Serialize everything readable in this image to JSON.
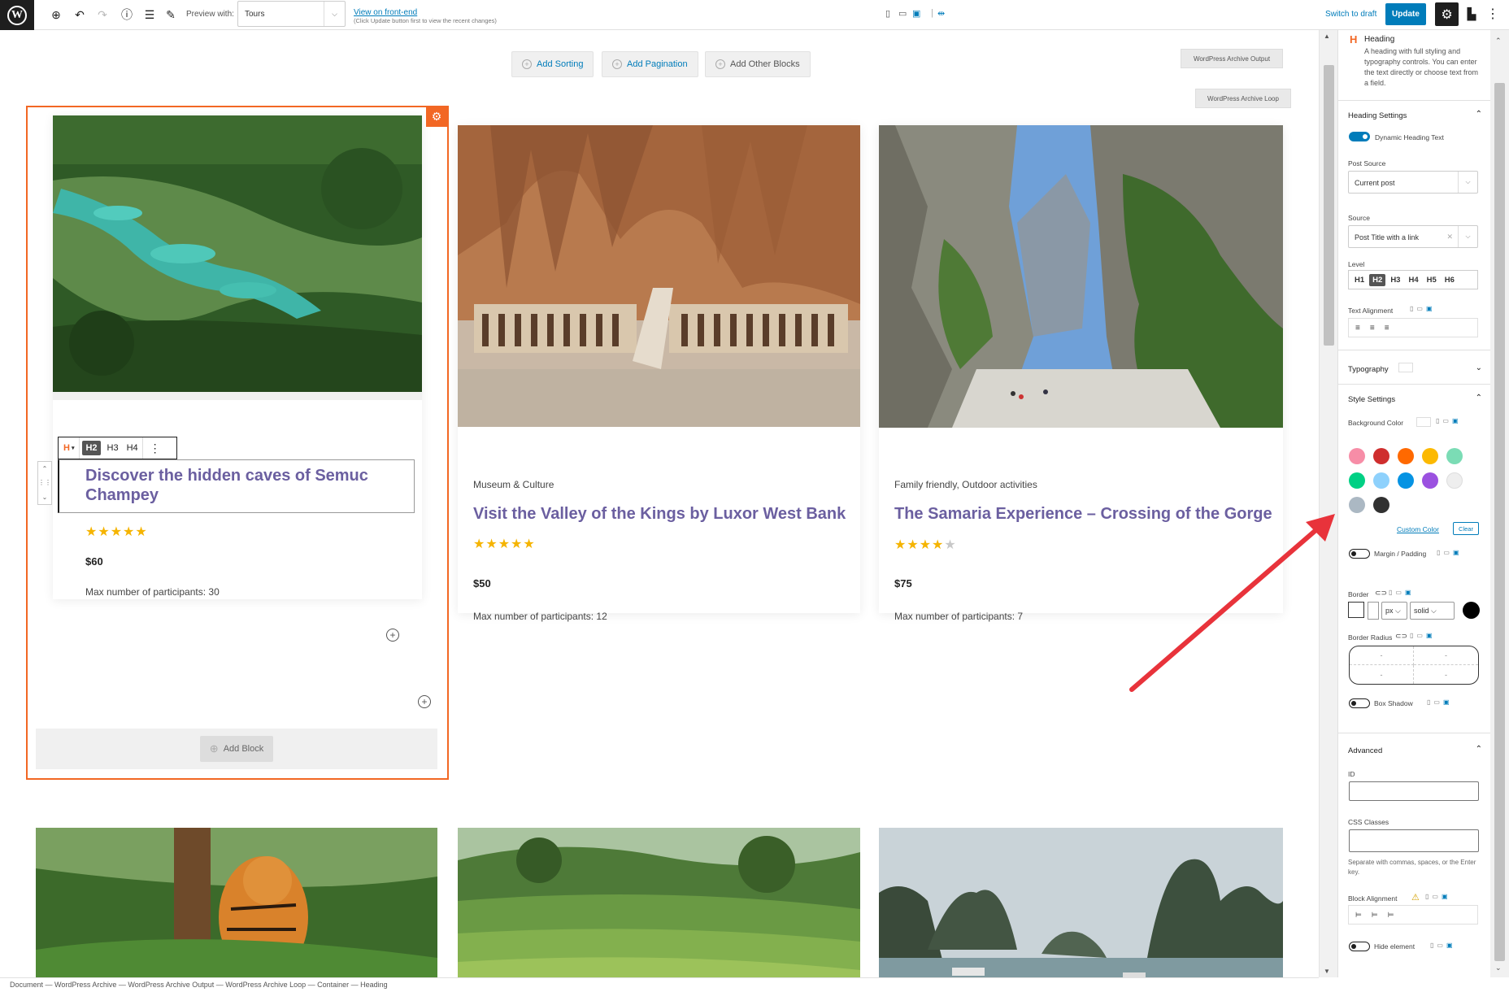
{
  "topbar": {
    "preview_label": "Preview with:",
    "preview_value": "Tours",
    "view_link": "View on front-end",
    "view_note": "(Click Update button first to view the recent changes)",
    "switch_draft": "Switch to draft",
    "update_label": "Update"
  },
  "canvas": {
    "add_sorting": "Add Sorting",
    "add_pagination": "Add Pagination",
    "add_other_blocks": "Add Other Blocks",
    "archive_output_label": "WordPress Archive Output",
    "archive_loop_label": "WordPress Archive Loop",
    "add_block_label": "Add Block"
  },
  "heading_toolbar": {
    "h_label": "H",
    "levels": [
      "H2",
      "H3",
      "H4"
    ]
  },
  "cards": [
    {
      "title": "Discover the hidden caves of Semuc Champey",
      "category": "",
      "stars_on": "★★★★★",
      "stars_off": "",
      "price": "$60",
      "max_participants": "Max number of participants: 30"
    },
    {
      "title": "Visit the Valley of the Kings by Luxor West Bank",
      "category": "Museum & Culture",
      "stars_on": "★★★★★",
      "stars_off": "",
      "price": "$50",
      "max_participants": "Max number of participants: 12"
    },
    {
      "title": "The Samaria Experience – Crossing of the Gorge",
      "category": "Family friendly, Outdoor activities",
      "stars_on": "★★★★",
      "stars_off": "★",
      "price": "$75",
      "max_participants": "Max number of participants: 7"
    }
  ],
  "breadcrumb": "Document  —  WordPress Archive  —  WordPress Archive Output  —  WordPress Archive Loop  —  Container  —  Heading",
  "sidebar": {
    "block_name": "Heading",
    "block_desc": "A heading with full styling and typography controls. You can enter the text directly or choose text from a field.",
    "heading_settings": "Heading Settings",
    "dynamic_heading": "Dynamic Heading Text",
    "post_source_label": "Post Source",
    "post_source_value": "Current post",
    "source_label": "Source",
    "source_value": "Post Title with a link",
    "level_label": "Level",
    "levels": [
      "H1",
      "H2",
      "H3",
      "H4",
      "H5",
      "H6"
    ],
    "active_level": "H2",
    "text_alignment": "Text Alignment",
    "typography": "Typography",
    "style_settings": "Style Settings",
    "background_color": "Background Color",
    "swatches": [
      "#f78da7",
      "#cf2e2e",
      "#ff6900",
      "#fcb900",
      "#7bdcb5",
      "#00d084",
      "#8ed1fc",
      "#0693e3",
      "#9b51e0",
      "#eeeeee",
      "#abb8c3",
      "#313131"
    ],
    "custom_color": "Custom Color",
    "clear": "Clear",
    "margin_padding": "Margin / Padding",
    "border": "Border",
    "border_unit": "px",
    "border_style": "solid",
    "border_radius": "Border Radius",
    "radius_placeholder": "-",
    "box_shadow": "Box Shadow",
    "advanced": "Advanced",
    "id_label": "ID",
    "css_classes": "CSS Classes",
    "css_help": "Separate with commas, spaces, or the Enter key.",
    "block_alignment": "Block Alignment",
    "hide_element": "Hide element"
  },
  "colors": {
    "accent": "#007cba",
    "selection": "#f26724",
    "title": "#6b5fa0",
    "star": "#f5b400",
    "arrow": "#e8333b"
  }
}
